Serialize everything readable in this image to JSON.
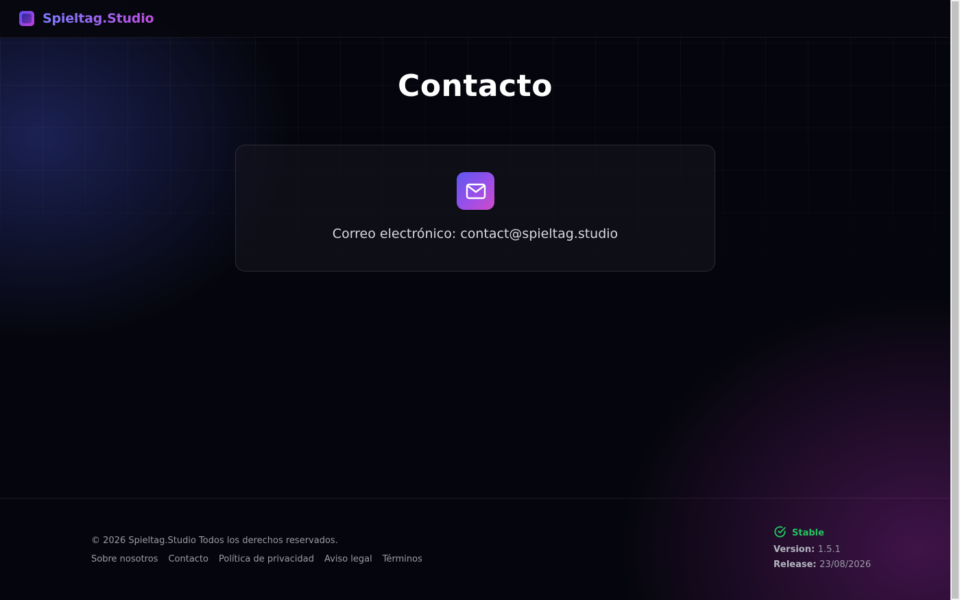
{
  "header": {
    "brand": "Spieltag.Studio",
    "logo_icon": "logo-icon"
  },
  "main": {
    "title": "Contacto",
    "card": {
      "icon": "mail-icon",
      "email_text": "Correo electrónico: contact@spieltag.studio"
    }
  },
  "footer": {
    "copyright": "© 2026 Spieltag.Studio Todos los derechos reservados.",
    "links": [
      "Sobre nosotros",
      "Contacto",
      "Política de privacidad",
      "Aviso legal",
      "Términos"
    ],
    "status": {
      "label": "Stable",
      "icon": "check-circle-icon",
      "color": "#22c55e",
      "version_label": "Version:",
      "version_value": "1.5.1",
      "release_label": "Release:",
      "release_value": "23/08/2026"
    }
  },
  "colors": {
    "background": "#05060d",
    "accent_start": "#5b4df0",
    "accent_end": "#c23fd6"
  }
}
